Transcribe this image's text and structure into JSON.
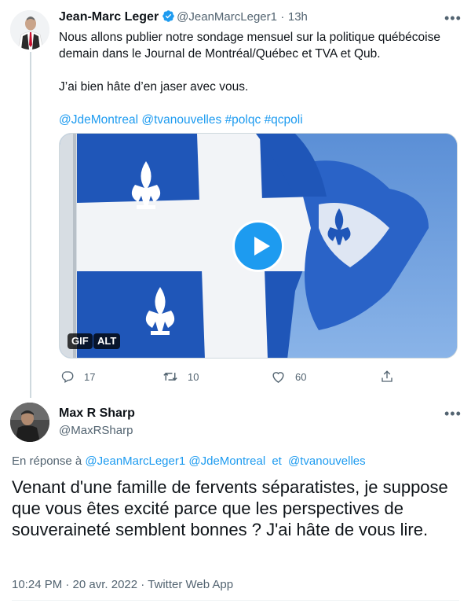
{
  "colors": {
    "link": "#1d9bf0",
    "muted": "#536471",
    "text": "#0f1419",
    "verified": "#1d9bf0",
    "flag_blue": "#1f56b8"
  },
  "tweet": {
    "author_name": "Jean-Marc Leger",
    "handle": "@JeanMarcLeger1",
    "separator": "·",
    "time": "13h",
    "text_line1": "Nous allons publier notre sondage mensuel sur la politique québécoise demain dans le Journal de Montréal/Québec et TVA et Qub.",
    "text_line2": "J’ai bien hâte d’en jaser avec vous.",
    "hashtag1": "@JdeMontreal",
    "hashtag2": "@tvanouvelles",
    "hashtag3": "#polqc",
    "hashtag4": "#qcpoli",
    "media": {
      "badge_gif": "GIF",
      "badge_alt": "ALT"
    },
    "actions": {
      "replies": "17",
      "retweets": "10",
      "likes": "60"
    }
  },
  "reply": {
    "author_name": "Max R Sharp",
    "handle": "@MaxRSharp",
    "reply_prefix": "En réponse à",
    "mention1": "@JeanMarcLeger1",
    "mention2": "@JdeMontreal",
    "and_word": "et",
    "mention3": "@tvanouvelles",
    "text": "Venant d'une famille de fervents séparatistes, je suppose que vous êtes excité parce que les perspectives de souveraineté semblent bonnes ? J'ai hâte de vous lire.",
    "timestamp": "10:24 PM · 20 avr. 2022 · Twitter Web App"
  },
  "icons": [
    "verified-icon",
    "more-icon",
    "reply-icon",
    "retweet-icon",
    "like-icon",
    "share-icon",
    "play-icon"
  ]
}
